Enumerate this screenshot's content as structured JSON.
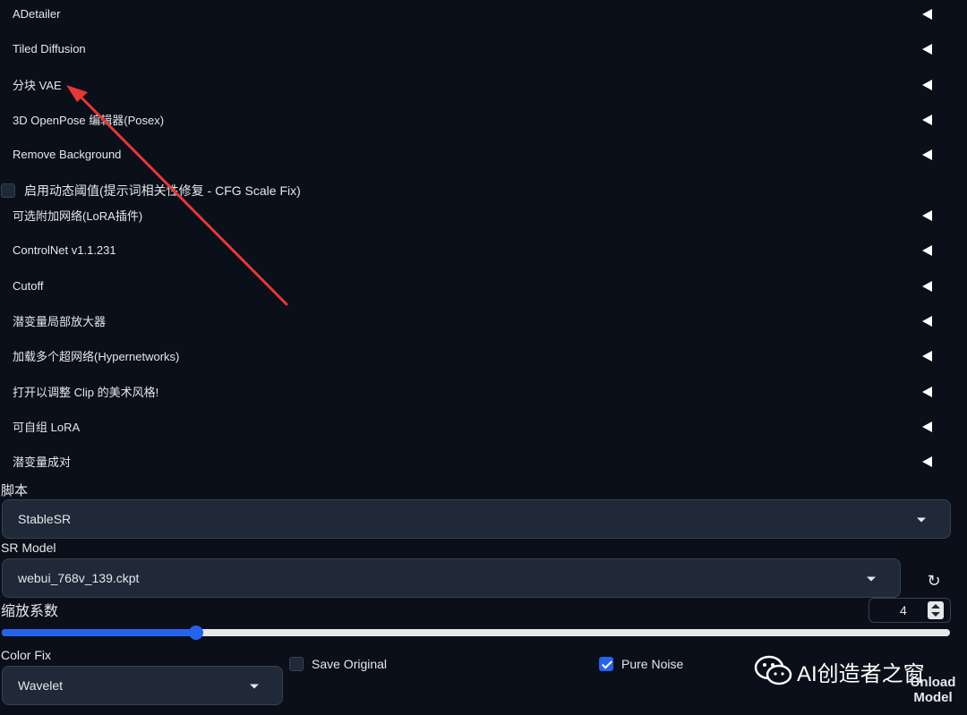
{
  "accordions_top": [
    {
      "label": "ADetailer"
    },
    {
      "label": "Tiled Diffusion"
    },
    {
      "label": "分块 VAE"
    },
    {
      "label": "3D OpenPose 编辑器(Posex)"
    },
    {
      "label": "Remove Background"
    }
  ],
  "cfg_fix": {
    "label": "启用动态阈值(提示词相关性修复 - CFG Scale Fix)",
    "checked": false
  },
  "accordions_bottom": [
    {
      "label": "可选附加网络(LoRA插件)"
    },
    {
      "label": "ControlNet v1.1.231"
    },
    {
      "label": "Cutoff"
    },
    {
      "label": "潜变量局部放大器"
    },
    {
      "label": "加载多个超网络(Hypernetworks)"
    },
    {
      "label": "打开以调整 Clip 的美术风格!"
    },
    {
      "label": "可自组 LoRA"
    },
    {
      "label": "潜变量成对"
    }
  ],
  "script": {
    "label": "脚本",
    "value": "StableSR"
  },
  "sr_model": {
    "label": "SR Model",
    "value": "webui_768v_139.ckpt",
    "refresh_icon": "↻"
  },
  "scale": {
    "label": "缩放系数",
    "value": "4",
    "slider_fraction": 0.205
  },
  "color_fix": {
    "label": "Color Fix",
    "value": "Wavelet"
  },
  "save_original": {
    "label": "Save Original",
    "checked": false
  },
  "pure_noise": {
    "label": "Pure Noise",
    "checked": true
  },
  "watermark": {
    "text": "AI创造者之窗",
    "icon": "wechat-icon"
  },
  "unload_model": {
    "line1": "Unload",
    "line2": "Model"
  },
  "annotation": {
    "color": "#e53935",
    "icon": "arrow-icon"
  },
  "colors": {
    "accent": "#2563eb",
    "background": "#0b0f19",
    "panel": "#1f2937"
  }
}
